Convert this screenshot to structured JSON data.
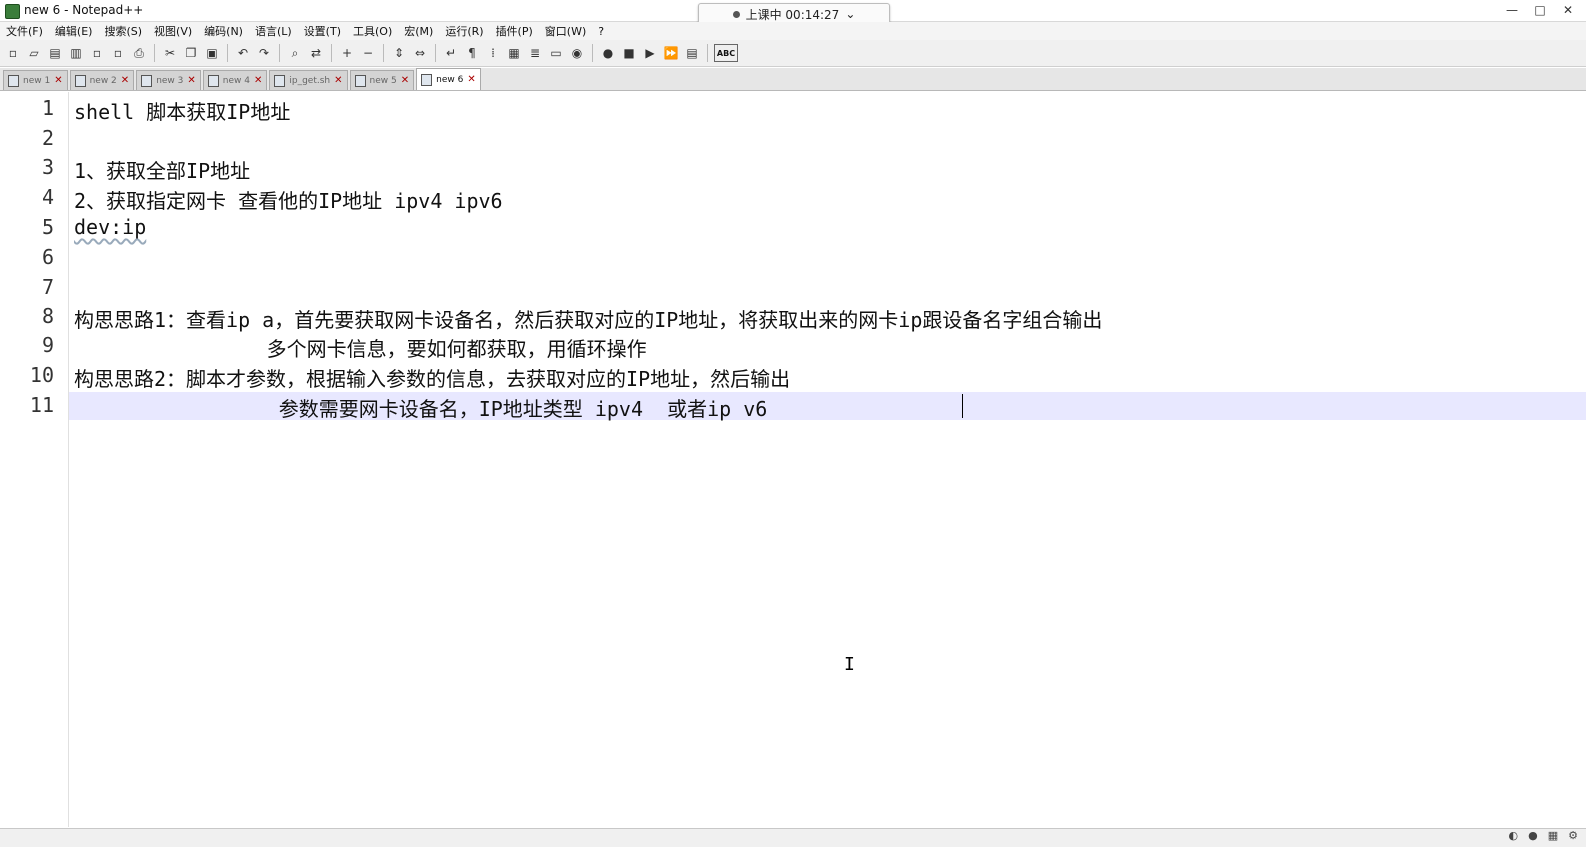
{
  "window": {
    "title": "new 6 - Notepad++",
    "controls": [
      "—",
      "□",
      "✕"
    ]
  },
  "recording": {
    "label": "上课中 00:14:27",
    "chevron": "⌄"
  },
  "menu": [
    "文件(F)",
    "编辑(E)",
    "搜索(S)",
    "视图(V)",
    "编码(N)",
    "语言(L)",
    "设置(T)",
    "工具(O)",
    "宏(M)",
    "运行(R)",
    "插件(P)",
    "窗口(W)",
    "?"
  ],
  "toolbar": {
    "spell_label": "ABC",
    "icons": [
      "new-file-icon",
      "open-file-icon",
      "save-icon",
      "save-all-icon",
      "close-icon",
      "close-all-icon",
      "print-icon",
      "cut-icon",
      "copy-icon",
      "paste-icon",
      "undo-icon",
      "redo-icon",
      "find-icon",
      "replace-icon",
      "zoom-in-icon",
      "zoom-out-icon",
      "sync-vertical-icon",
      "sync-horizontal-icon",
      "word-wrap-icon",
      "show-all-chars-icon",
      "indent-guide-icon",
      "document-map-icon",
      "function-list-icon",
      "folder-workspace-icon",
      "monitor-icon",
      "record-macro-icon",
      "stop-macro-icon",
      "play-macro-icon",
      "run-macro-multiple-icon",
      "save-macro-icon"
    ]
  },
  "tabs": [
    {
      "label": "new 1",
      "active": false
    },
    {
      "label": "new 2",
      "active": false
    },
    {
      "label": "new 3",
      "active": false
    },
    {
      "label": "new 4",
      "active": false
    },
    {
      "label": "ip_get.sh",
      "active": false
    },
    {
      "label": "new 5",
      "active": false
    },
    {
      "label": "new 6",
      "active": true
    }
  ],
  "editor": {
    "lines": [
      {
        "num": "1",
        "text": "shell 脚本获取IP地址"
      },
      {
        "num": "2",
        "text": ""
      },
      {
        "num": "3",
        "text": "1、获取全部IP地址"
      },
      {
        "num": "4",
        "text": "2、获取指定网卡 查看他的IP地址 ipv4 ipv6"
      },
      {
        "num": "5",
        "text": "dev:ip"
      },
      {
        "num": "6",
        "text": ""
      },
      {
        "num": "7",
        "text": ""
      },
      {
        "num": "8",
        "text": "构思思路1：查看ip a，首先要获取网卡设备名，然后获取对应的IP地址，将获取出来的网卡ip跟设备名字组合输出"
      },
      {
        "num": "9",
        "text": "                多个网卡信息，要如何都获取，用循环操作"
      },
      {
        "num": "10",
        "text": "构思思路2：脚本才参数，根据输入参数的信息，去获取对应的IP地址，然后输出"
      },
      {
        "num": "11",
        "text": "                 参数需要网卡设备名，IP地址类型 ipv4  或者ip v6"
      }
    ]
  }
}
